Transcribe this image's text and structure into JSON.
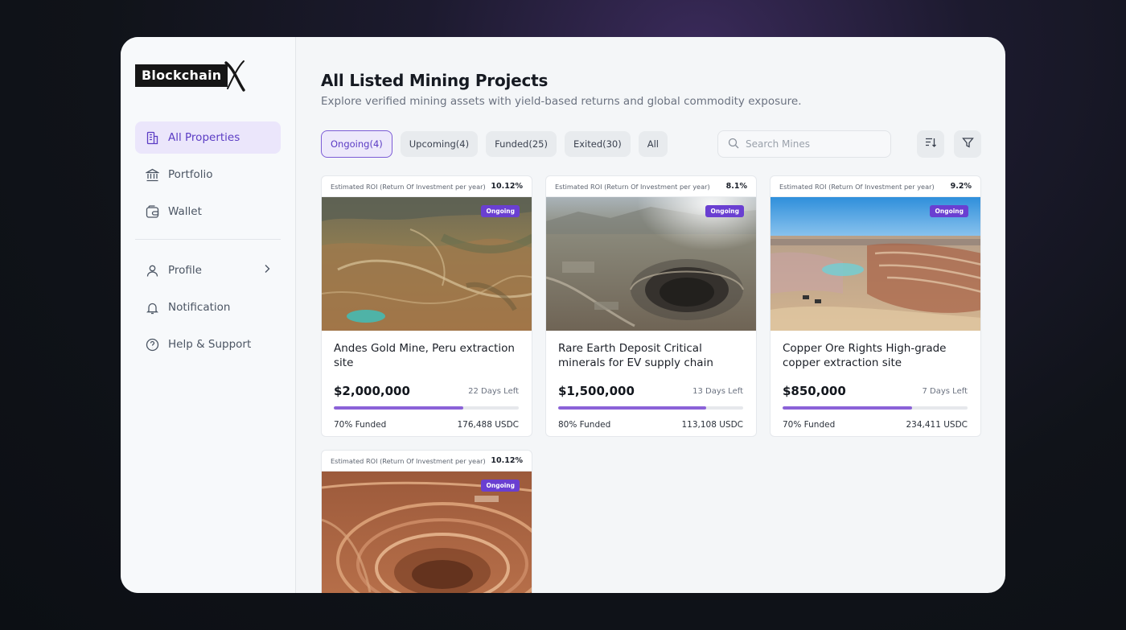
{
  "brand": {
    "name": "Blockchain",
    "x_mark": "X"
  },
  "sidebar": {
    "items": [
      {
        "label": "All Properties",
        "icon": "building-icon",
        "active": true
      },
      {
        "label": "Portfolio",
        "icon": "bank-icon",
        "active": false
      },
      {
        "label": "Wallet",
        "icon": "wallet-icon",
        "active": false
      }
    ],
    "secondary": [
      {
        "label": "Profile",
        "icon": "user-icon"
      },
      {
        "label": "Notification",
        "icon": "bell-icon"
      },
      {
        "label": "Help & Support",
        "icon": "help-icon"
      }
    ]
  },
  "header": {
    "title": "All Listed Mining Projects",
    "subtitle": "Explore verified mining assets with yield-based returns and global commodity exposure."
  },
  "tabs": [
    {
      "label": "Ongoing(4)",
      "active": true
    },
    {
      "label": "Upcoming(4)",
      "active": false
    },
    {
      "label": "Funded(25)",
      "active": false
    },
    {
      "label": "Exited(30)",
      "active": false
    },
    {
      "label": "All",
      "active": false
    }
  ],
  "search": {
    "placeholder": "Search Mines"
  },
  "roi_label": "Estimated ROI (Return Of Investment per year)",
  "cards": [
    {
      "roi": "10.12%",
      "status": "Ongoing",
      "title": "Andes Gold Mine, Peru extraction site",
      "price": "$2,000,000",
      "days_left": "22 Days Left",
      "funded": "70% Funded",
      "funded_pct": 70,
      "raised": "176,488 USDC"
    },
    {
      "roi": "8.1%",
      "status": "Ongoing",
      "title": "Rare Earth Deposit Critical minerals for EV supply chain",
      "price": "$1,500,000",
      "days_left": "13 Days Left",
      "funded": "80% Funded",
      "funded_pct": 80,
      "raised": "113,108 USDC"
    },
    {
      "roi": "9.2%",
      "status": "Ongoing",
      "title": "Copper Ore Rights High-grade copper extraction site",
      "price": "$850,000",
      "days_left": "7 Days Left",
      "funded": "70% Funded",
      "funded_pct": 70,
      "raised": "234,411 USDC"
    },
    {
      "roi": "10.12%",
      "status": "Ongoing"
    }
  ],
  "colors": {
    "accent": "#6a3fd1",
    "progress": "#8b62d8",
    "active_bg": "#ebe6fb"
  }
}
